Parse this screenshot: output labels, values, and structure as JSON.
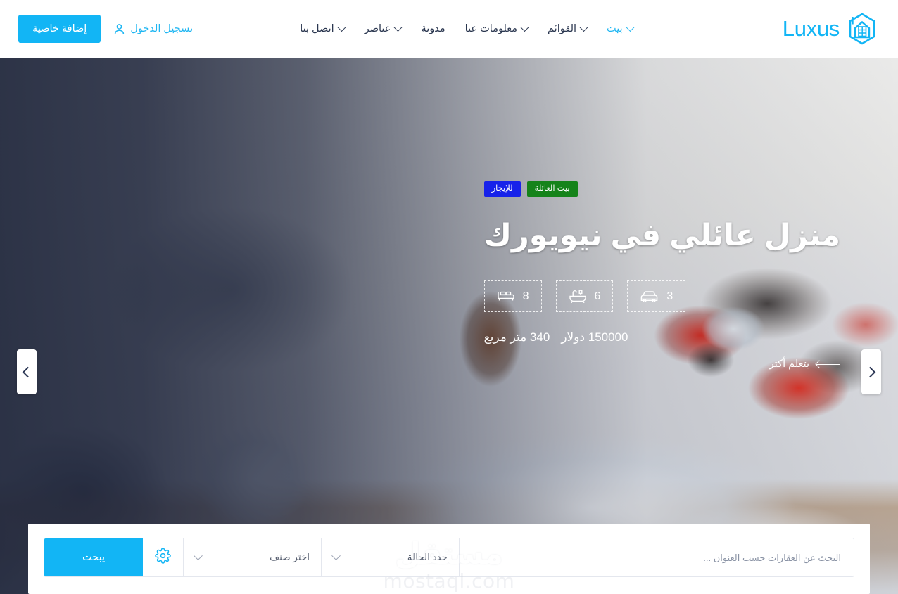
{
  "brand": {
    "name": "Luxus",
    "logo_icon": "hexagon-house-icon",
    "color": "#12b5f5"
  },
  "nav": {
    "items": [
      {
        "label": "بيت",
        "icon": "chevron-down-icon",
        "has_caret": true,
        "active": true
      },
      {
        "label": "القوائم",
        "icon": "chevron-down-icon",
        "has_caret": true,
        "active": false
      },
      {
        "label": "معلومات عنا",
        "icon": "chevron-down-icon",
        "has_caret": true,
        "active": false
      },
      {
        "label": "مدونة",
        "icon": null,
        "has_caret": false,
        "active": false
      },
      {
        "label": "عناصر",
        "icon": "chevron-down-icon",
        "has_caret": true,
        "active": false
      },
      {
        "label": "اتصل بنا",
        "icon": "chevron-down-icon",
        "has_caret": true,
        "active": false
      }
    ]
  },
  "header_actions": {
    "login_label": "تسجيل الدخول",
    "login_icon": "user-icon",
    "add_property_label": "إضافة خاصية",
    "add_property_color": "#12b5f5"
  },
  "hero": {
    "badges": [
      {
        "label": "للإيجار",
        "color": "#1722ea"
      },
      {
        "label": "بيت العائلة",
        "color": "#15831a"
      }
    ],
    "title": "منزل عائلي في نيويورك",
    "features": [
      {
        "icon": "bed-icon",
        "value": "8"
      },
      {
        "icon": "bathtub-icon",
        "value": "6"
      },
      {
        "icon": "car-icon",
        "value": "3"
      }
    ],
    "meta": {
      "area": "340 متر مربع",
      "price": "150000 دولار"
    },
    "more_link": "يتعلم أكثر",
    "more_icon": "arrow-left-icon",
    "prev_icon": "chevron-left-icon",
    "next_icon": "chevron-right-icon"
  },
  "watermark": {
    "arabic": "مستقل",
    "latin": "mostaql.com"
  },
  "search": {
    "placeholder": "البحث عن العقارات حسب العنوان ...",
    "value": "",
    "status_select": {
      "label": "حدد الحالة",
      "caret_icon": "chevron-down-icon"
    },
    "category_select": {
      "label": "اختر صنف",
      "caret_icon": "chevron-down-icon"
    },
    "advanced_icon": "gear-icon",
    "submit_label": "يبحث",
    "submit_color": "#12b5f5"
  }
}
